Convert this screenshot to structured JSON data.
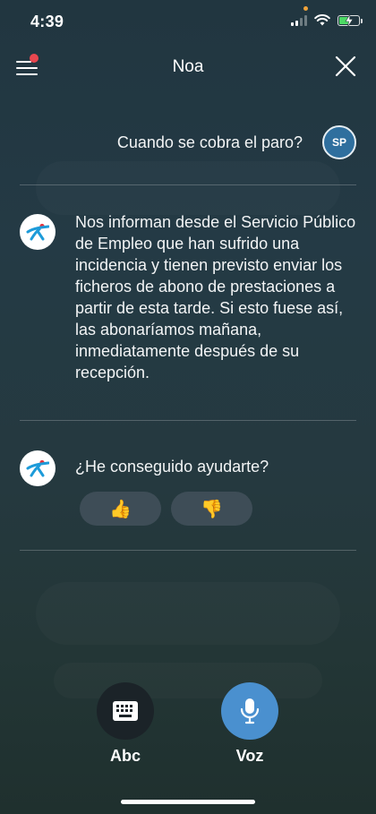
{
  "status_bar": {
    "time": "4:39"
  },
  "header": {
    "title": "Noa"
  },
  "user_message": {
    "text": "Cuando se cobra el paro?",
    "avatar_initials": "SP"
  },
  "bot_messages": [
    {
      "text": "Nos informan desde el Servicio Público de Empleo que han sufrido una incidencia y tienen previsto enviar los ficheros de abono de prestaciones a partir de esta tarde. Si esto fuese así, las abonaríamos mañana, inmediatamente después de su recepción."
    },
    {
      "text": "¿He conseguido ayudarte?"
    }
  ],
  "feedback": {
    "positive": "👍",
    "negative": "👎"
  },
  "controls": {
    "keyboard": {
      "label": "Abc",
      "icon": "keyboard-icon"
    },
    "voice": {
      "label": "Voz",
      "icon": "microphone-icon"
    }
  },
  "colors": {
    "avatar_bg": "#2f6f9e",
    "voice_button": "#4a90cf",
    "keyboard_button": "#1b2328",
    "menu_badge": "#e8474f",
    "bot_logo_blue": "#1d9bd9",
    "bot_logo_red": "#e5343d"
  }
}
